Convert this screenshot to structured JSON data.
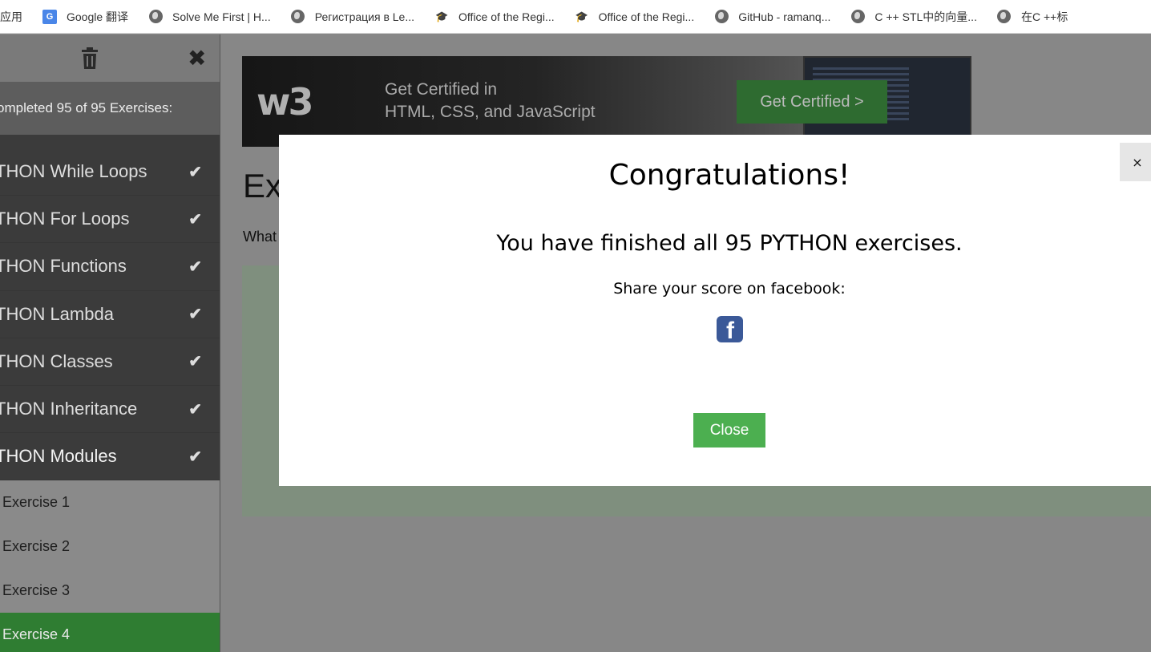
{
  "bookmarks": [
    {
      "label": "应用",
      "icon": "apps-icon"
    },
    {
      "label": "Google 翻译",
      "icon": "google-translate-icon"
    },
    {
      "label": "Solve Me First | H...",
      "icon": "globe-icon"
    },
    {
      "label": "Регистрация в Le...",
      "icon": "globe-icon"
    },
    {
      "label": "Office of the Regi...",
      "icon": "graduation-cap-icon"
    },
    {
      "label": "Office of the Regi...",
      "icon": "graduation-cap-icon"
    },
    {
      "label": "GitHub - ramanq...",
      "icon": "globe-icon"
    },
    {
      "label": "C ++ STL中的向量...",
      "icon": "globe-icon"
    },
    {
      "label": "在C ++标",
      "icon": "globe-icon"
    }
  ],
  "sidebar": {
    "progress_text": "ompleted 95 of 95 Exercises:",
    "chapters": [
      {
        "label": "THON While Loops",
        "done": "✔"
      },
      {
        "label": "THON For Loops",
        "done": "✔"
      },
      {
        "label": "THON Functions",
        "done": "✔"
      },
      {
        "label": "THON Lambda",
        "done": "✔"
      },
      {
        "label": "THON Classes",
        "done": "✔"
      },
      {
        "label": "THON Inheritance",
        "done": "✔"
      },
      {
        "label": "THON Modules",
        "done": "✔"
      }
    ],
    "exercises": [
      {
        "label": "Exercise 1"
      },
      {
        "label": "Exercise 2"
      },
      {
        "label": "Exercise 3"
      },
      {
        "label": "Exercise 4"
      }
    ],
    "active_exercise": "Exercise 4"
  },
  "ad": {
    "logo": "w3",
    "line1": "Get Certified in",
    "line2": "HTML, CSS, and JavaScript",
    "button": "Get Certified >"
  },
  "main": {
    "title": "Ex",
    "question": "What"
  },
  "modal": {
    "close_x": "×",
    "title": "Congratulations!",
    "message": "You have finished all 95 PYTHON exercises.",
    "share": "Share your score on facebook:",
    "close_button": "Close"
  },
  "colors": {
    "sidebar_bg": "#3b3b3b",
    "active_exercise": "#2f7d32",
    "close_button": "#4caf50",
    "facebook": "#3b5998"
  }
}
